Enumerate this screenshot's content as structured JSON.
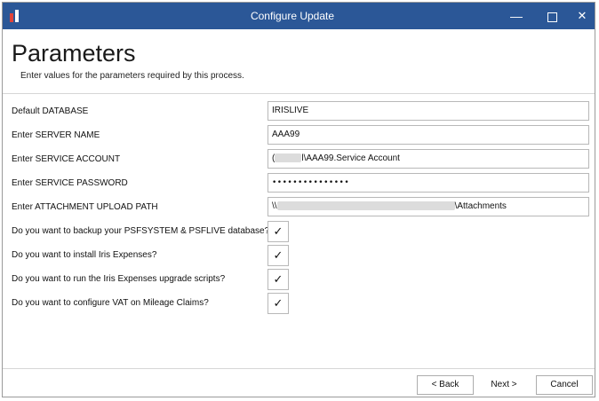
{
  "window": {
    "title": "Configure Update",
    "controls": {
      "minimize": "—",
      "close": "✕"
    }
  },
  "header": {
    "title": "Parameters",
    "subtitle": "Enter values for the parameters required by this process."
  },
  "fields": [
    {
      "label": "Default DATABASE",
      "value": "IRISLIVE"
    },
    {
      "label": "Enter SERVER NAME",
      "value": "AAA99"
    },
    {
      "label": "Enter SERVICE ACCOUNT",
      "prefix": "(",
      "value": "l\\AAA99.Service Account"
    },
    {
      "label": "Enter SERVICE PASSWORD",
      "value": "•••••••••••••••"
    },
    {
      "label": "Enter ATTACHMENT UPLOAD PATH",
      "prefix": "\\\\",
      "value": "\\Attachments"
    }
  ],
  "checkboxes": [
    {
      "label": "Do you want to backup your PSFSYSTEM & PSFLIVE database?",
      "checked": true,
      "mark": "✓"
    },
    {
      "label": "Do you want to install Iris Expenses?",
      "checked": true,
      "mark": "✓"
    },
    {
      "label": "Do you want to run the Iris Expenses upgrade scripts?",
      "checked": true,
      "mark": "✓"
    },
    {
      "label": "Do you want to configure VAT on Mileage Claims?",
      "checked": true,
      "mark": "✓"
    }
  ],
  "buttons": {
    "back": "< Back",
    "next": "Next >",
    "cancel": "Cancel"
  },
  "colors": {
    "titlebar": "#2b5797",
    "icon_accent": "#e0443a"
  }
}
